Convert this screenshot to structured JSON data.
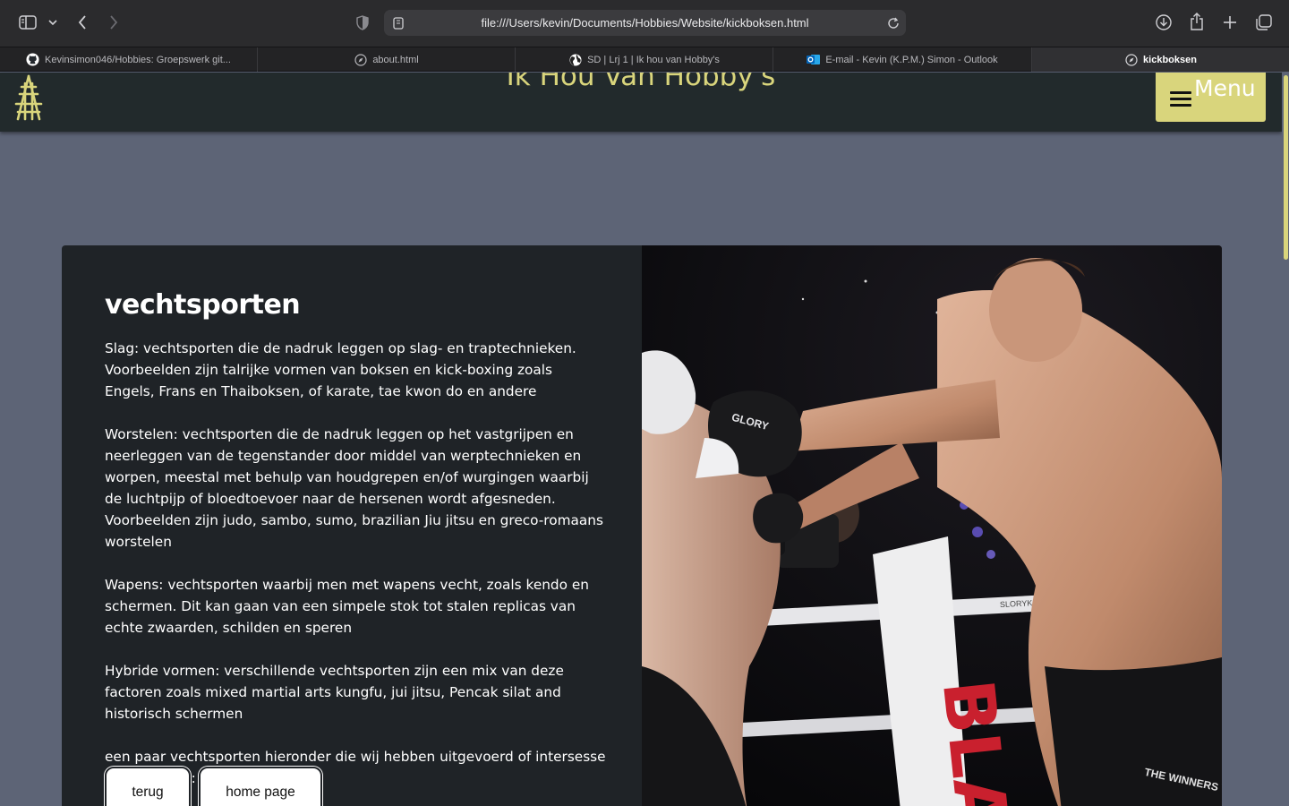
{
  "browser": {
    "url": "file:///Users/kevin/Documents/Hobbies/Website/kickboksen.html",
    "tabs": [
      {
        "label": "Kevinsimon046/Hobbies: Groepswerk git...",
        "icon": "github-icon",
        "active": false
      },
      {
        "label": "about.html",
        "icon": "compass-icon",
        "active": false
      },
      {
        "label": "SD | Lrj 1 | Ik hou van Hobby's",
        "icon": "globe-icon",
        "active": false
      },
      {
        "label": "E-mail - Kevin (K.P.M.) Simon - Outlook",
        "icon": "outlook-icon",
        "active": false
      },
      {
        "label": "kickboksen",
        "icon": "compass-icon",
        "active": true
      }
    ]
  },
  "site": {
    "title": "Ik Hou Van Hobby's",
    "menu_label": "Menu",
    "logo": "tower-logo-icon"
  },
  "content": {
    "heading": "vechtsporten",
    "paragraphs": [
      "Slag: vechtsporten die de nadruk leggen op slag- en traptechnieken. Voorbeelden zijn talrijke vormen van boksen en kick-boxing zoals Engels, Frans en Thaiboksen, of karate, tae kwon do en andere",
      "Worstelen: vechtsporten die de nadruk leggen op het vastgrijpen en neerleggen van de tegenstander door middel van werptechnieken en worpen, meestal met behulp van houdgrepen en/of wurgingen waarbij de luchtpijp of bloedtoevoer naar de hersenen wordt afgesneden. Voorbeelden zijn judo, sambo, sumo, brazilian Jiu jitsu en greco-romaans worstelen",
      "Wapens: vechtsporten waarbij men met wapens vecht, zoals kendo en schermen. Dit kan gaan van een simpele stok tot stalen replicas van echte zwaarden, schilden en speren",
      "Hybride vormen: verschillende vechtsporten zijn een mix van deze factoren zoals mixed martial arts kungfu, jui jitsu, Pencak silat and historisch schermen",
      "een paar vechtsporten hieronder die wij hebben uitgevoerd of intersesse over hebben:"
    ],
    "buttons": {
      "back": "terug",
      "home": "home page"
    },
    "image": {
      "glove_text": "GLORY",
      "banner_text": "BLA",
      "ring_text": "SLORYKICKBOXING",
      "shorts_text": "THE WINNERS WORKOUT"
    }
  },
  "colors": {
    "accent": "#d9d57c",
    "header_bg": "#222a2c",
    "page_bg": "#5d6476",
    "card_bg": "#1f2327"
  }
}
